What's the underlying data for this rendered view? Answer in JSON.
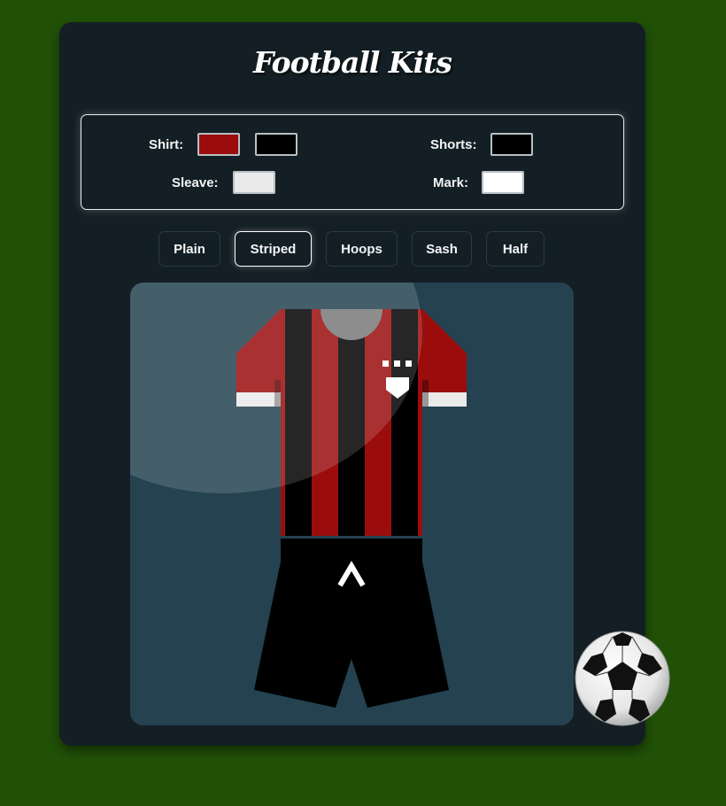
{
  "app": {
    "title": "Football Kits"
  },
  "controls": {
    "shirt": {
      "label": "Shirt:",
      "colors": [
        "#9b0d0d",
        "#000000"
      ]
    },
    "sleeve": {
      "label": "Sleave:",
      "color": "#eaeaea"
    },
    "shorts": {
      "label": "Shorts:",
      "color": "#000000"
    },
    "mark": {
      "label": "Mark:",
      "color": "#ffffff"
    }
  },
  "patterns": {
    "items": [
      {
        "label": "Plain"
      },
      {
        "label": "Striped"
      },
      {
        "label": "Hoops"
      },
      {
        "label": "Sash"
      },
      {
        "label": "Half"
      }
    ],
    "selected": "Striped"
  },
  "colors": {
    "background": "#215107",
    "card": "#131f24",
    "stage": "#244250"
  },
  "icons": {
    "crest": "shield-icon",
    "ball": "soccer-ball-icon"
  }
}
